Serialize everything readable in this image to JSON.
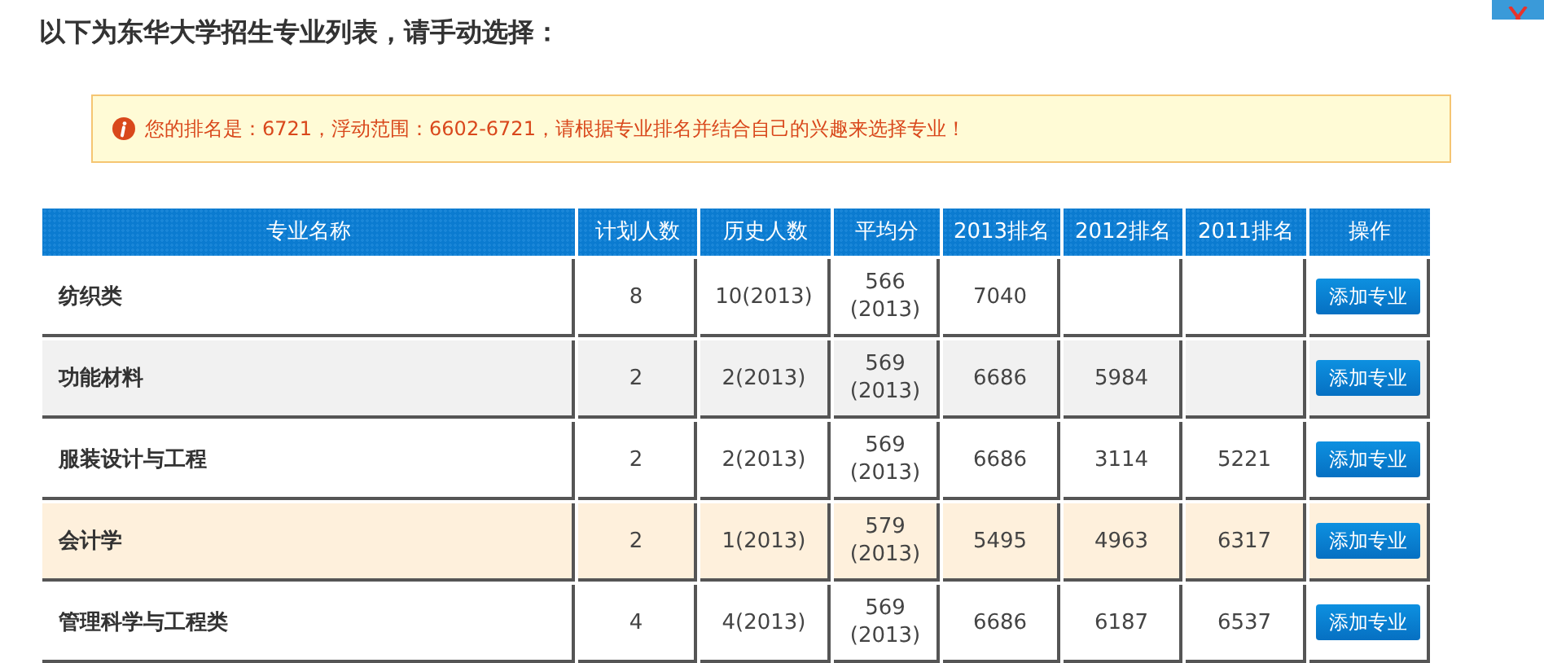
{
  "title": "以下为东华大学招生专业列表，请手动选择：",
  "alert": {
    "text": "您的排名是：6721，浮动范围：6602-6721，请根据专业排名并结合自己的兴趣来选择专业！"
  },
  "table": {
    "columns": [
      "专业名称",
      "计划人数",
      "历史人数",
      "平均分",
      "2013排名",
      "2012排名",
      "2011排名",
      "操作"
    ],
    "rows": [
      {
        "kind": "normal",
        "cells": [
          "纺织类",
          "8",
          "10(2013)",
          "566\n(2013)",
          "7040",
          "",
          ""
        ],
        "action": "添加专业"
      },
      {
        "kind": "hover",
        "cells": [
          "功能材料",
          "2",
          "2(2013)",
          "569\n(2013)",
          "6686",
          "5984",
          ""
        ],
        "action": "添加专业"
      },
      {
        "kind": "normal",
        "cells": [
          "服装设计与工程",
          "2",
          "2(2013)",
          "569\n(2013)",
          "6686",
          "3114",
          "5221"
        ],
        "action": "添加专业"
      },
      {
        "kind": "match",
        "cells": [
          "会计学",
          "2",
          "1(2013)",
          "579\n(2013)",
          "5495",
          "4963",
          "6317"
        ],
        "action": "添加专业"
      },
      {
        "kind": "normal",
        "cells": [
          "管理科学与工程类",
          "4",
          "4(2013)",
          "569\n(2013)",
          "6686",
          "6187",
          "6537"
        ],
        "action": "添加专业"
      }
    ]
  }
}
